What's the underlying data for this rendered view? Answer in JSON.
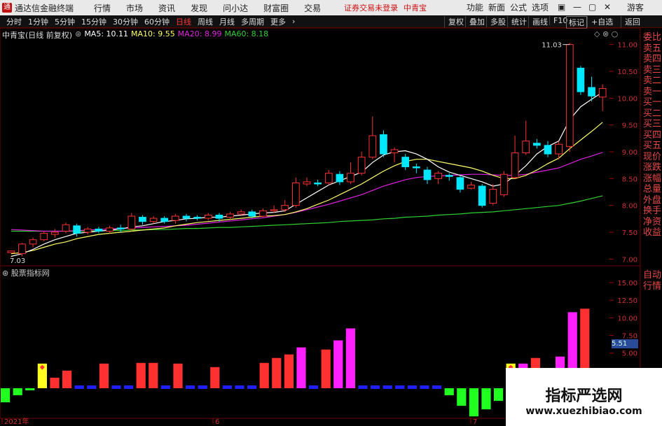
{
  "titlebar": {
    "app_title": "通达信金融终端",
    "menus": [
      "行情",
      "市场",
      "资讯",
      "发现",
      "问小达",
      "财富圈",
      "交易"
    ],
    "notice": "证券交易未登录",
    "stock_name": "中青宝",
    "right_menus": [
      "功能",
      "新面",
      "公式",
      "选项"
    ],
    "guest": "游客"
  },
  "toolbar": {
    "periods": [
      "分时",
      "1分钟",
      "5分钟",
      "15分钟",
      "30分钟",
      "60分钟",
      "日线",
      "周线",
      "月线",
      "多周期",
      "更多"
    ],
    "active_index": 6,
    "right_buttons": [
      "复权",
      "叠加",
      "多股",
      "统计",
      "画线",
      "F10",
      "标记",
      "+自选",
      "返回"
    ]
  },
  "info": {
    "title": "中青宝(日线 前复权)",
    "ma5": "MA5: 10.11",
    "ma10": "MA10: 9.55",
    "ma20": "MA20: 8.99",
    "ma60": "MA60: 8.18"
  },
  "colors": {
    "up": "#ff3030",
    "down": "#00e8ff",
    "ma5": "#ffffff",
    "ma10": "#ffff66",
    "ma20": "#e020e0",
    "ma60": "#30d030",
    "magenta_bar": "#ff20ff",
    "blue_bar": "#2020ff",
    "green_bar": "#20ff20",
    "yellow_bar": "#ffff20"
  },
  "sidebar": [
    "委比",
    "卖五",
    "卖四",
    "卖三",
    "卖二",
    "卖一",
    "买一",
    "买二",
    "买三",
    "买四",
    "买五",
    "现价",
    "涨跌",
    "涨幅",
    "总量",
    "外盘",
    "换手",
    "净资",
    "收益"
  ],
  "sidebar2": [
    "自动",
    "行情"
  ],
  "indicator_panel": {
    "name": "股票指标网",
    "current_value": "5.51"
  },
  "watermark": {
    "line1": "指标严选网",
    "line2": "www.xuezhibiao.com"
  },
  "chart_data": {
    "type": "candlestick",
    "price_axis": {
      "ticks": [
        7.0,
        7.5,
        8.0,
        8.5,
        9.0,
        9.5,
        10.0,
        10.5,
        11.0
      ],
      "labels": [
        "7.00",
        "7.50",
        "8.00",
        "8.50",
        "9.00",
        "9.50",
        "10.00",
        "10.50",
        "11.00"
      ],
      "range": [
        6.9,
        11.1
      ]
    },
    "annotations": {
      "high": "11.03",
      "low": "7.03"
    },
    "x_labels": [
      "2021年",
      "6",
      "7"
    ],
    "candles": [
      [
        7.12,
        7.15,
        7.04,
        7.03
      ],
      [
        7.1,
        7.28,
        7.3,
        7.05
      ],
      [
        7.28,
        7.36,
        7.4,
        7.22
      ],
      [
        7.36,
        7.48,
        7.52,
        7.33
      ],
      [
        7.46,
        7.5,
        7.56,
        7.4
      ],
      [
        7.52,
        7.64,
        7.68,
        7.48
      ],
      [
        7.62,
        7.48,
        7.66,
        7.42
      ],
      [
        7.5,
        7.56,
        7.6,
        7.46
      ],
      [
        7.56,
        7.52,
        7.6,
        7.48
      ],
      [
        7.52,
        7.58,
        7.62,
        7.48
      ],
      [
        7.58,
        7.56,
        7.64,
        7.5
      ],
      [
        7.56,
        7.8,
        7.86,
        7.52
      ],
      [
        7.78,
        7.7,
        7.82,
        7.64
      ],
      [
        7.7,
        7.76,
        7.8,
        7.66
      ],
      [
        7.76,
        7.7,
        7.8,
        7.66
      ],
      [
        7.72,
        7.8,
        7.84,
        7.66
      ],
      [
        7.8,
        7.76,
        7.84,
        7.7
      ],
      [
        7.78,
        7.76,
        7.82,
        7.72
      ],
      [
        7.76,
        7.82,
        7.86,
        7.72
      ],
      [
        7.82,
        7.76,
        7.86,
        7.7
      ],
      [
        7.78,
        7.84,
        7.88,
        7.74
      ],
      [
        7.84,
        7.88,
        7.92,
        7.8
      ],
      [
        7.88,
        7.8,
        7.92,
        7.76
      ],
      [
        7.8,
        7.9,
        7.94,
        7.78
      ],
      [
        7.9,
        7.92,
        8.0,
        7.86
      ],
      [
        7.92,
        8.0,
        8.1,
        7.88
      ],
      [
        8.0,
        8.42,
        8.52,
        7.96
      ],
      [
        8.4,
        8.44,
        8.52,
        8.36
      ],
      [
        8.42,
        8.4,
        8.48,
        8.36
      ],
      [
        8.42,
        8.6,
        8.66,
        8.38
      ],
      [
        8.58,
        8.44,
        8.64,
        8.38
      ],
      [
        8.44,
        8.6,
        8.8,
        8.4
      ],
      [
        8.6,
        8.9,
        9.0,
        8.56
      ],
      [
        8.9,
        9.3,
        9.66,
        8.86
      ],
      [
        9.32,
        8.96,
        9.4,
        8.9
      ],
      [
        8.98,
        9.04,
        9.08,
        8.8
      ],
      [
        8.9,
        8.72,
        8.96,
        8.66
      ],
      [
        8.72,
        8.7,
        8.78,
        8.6
      ],
      [
        8.66,
        8.48,
        8.72,
        8.4
      ],
      [
        8.5,
        8.6,
        8.64,
        8.4
      ],
      [
        8.56,
        8.54,
        8.6,
        8.46
      ],
      [
        8.52,
        8.3,
        8.56,
        8.24
      ],
      [
        8.32,
        8.38,
        8.44,
        8.3
      ],
      [
        8.36,
        8.0,
        8.4,
        7.96
      ],
      [
        8.04,
        8.3,
        8.4,
        8.0
      ],
      [
        8.2,
        8.58,
        8.64,
        8.16
      ],
      [
        8.52,
        8.98,
        9.3,
        8.5
      ],
      [
        8.98,
        9.2,
        9.58,
        8.94
      ],
      [
        9.16,
        9.12,
        9.24,
        9.06
      ],
      [
        9.12,
        8.96,
        9.2,
        8.9
      ],
      [
        8.96,
        9.14,
        9.2,
        8.86
      ],
      [
        9.1,
        11.0,
        11.03,
        9.0
      ],
      [
        10.56,
        10.12,
        10.6,
        10.06
      ],
      [
        10.2,
        10.04,
        10.4,
        9.94
      ],
      [
        10.02,
        10.18,
        10.26,
        9.76
      ]
    ],
    "ma5": [
      7.05,
      7.1,
      7.18,
      7.28,
      7.36,
      7.42,
      7.48,
      7.5,
      7.52,
      7.54,
      7.56,
      7.6,
      7.62,
      7.66,
      7.7,
      7.72,
      7.75,
      7.76,
      7.78,
      7.78,
      7.8,
      7.82,
      7.84,
      7.86,
      7.87,
      7.9,
      8.02,
      8.14,
      8.26,
      8.38,
      8.46,
      8.54,
      8.62,
      8.8,
      8.94,
      9.0,
      9.02,
      8.96,
      8.86,
      8.72,
      8.62,
      8.56,
      8.5,
      8.44,
      8.36,
      8.4,
      8.56,
      8.74,
      8.96,
      9.1,
      9.2,
      9.6,
      9.84,
      9.98,
      10.11
    ],
    "ma10": [
      7.1,
      7.12,
      7.16,
      7.22,
      7.28,
      7.32,
      7.38,
      7.42,
      7.46,
      7.48,
      7.5,
      7.52,
      7.54,
      7.56,
      7.58,
      7.62,
      7.65,
      7.68,
      7.7,
      7.72,
      7.74,
      7.76,
      7.78,
      7.8,
      7.81,
      7.83,
      7.88,
      7.94,
      8.02,
      8.1,
      8.2,
      8.3,
      8.4,
      8.52,
      8.64,
      8.74,
      8.82,
      8.86,
      8.86,
      8.82,
      8.78,
      8.74,
      8.7,
      8.64,
      8.56,
      8.5,
      8.5,
      8.56,
      8.66,
      8.78,
      8.88,
      9.06,
      9.22,
      9.38,
      9.55
    ],
    "ma20": [
      7.55,
      7.54,
      7.53,
      7.52,
      7.52,
      7.52,
      7.53,
      7.54,
      7.55,
      7.56,
      7.57,
      7.58,
      7.59,
      7.6,
      7.61,
      7.62,
      7.63,
      7.65,
      7.67,
      7.69,
      7.71,
      7.73,
      7.75,
      7.77,
      7.8,
      7.83,
      7.87,
      7.92,
      7.97,
      8.02,
      8.08,
      8.14,
      8.2,
      8.28,
      8.36,
      8.42,
      8.48,
      8.52,
      8.54,
      8.55,
      8.56,
      8.57,
      8.58,
      8.58,
      8.57,
      8.56,
      8.56,
      8.58,
      8.62,
      8.66,
      8.7,
      8.78,
      8.86,
      8.92,
      8.99
    ],
    "ma60": [
      7.52,
      7.52,
      7.52,
      7.52,
      7.52,
      7.52,
      7.52,
      7.52,
      7.53,
      7.53,
      7.53,
      7.54,
      7.54,
      7.55,
      7.55,
      7.56,
      7.57,
      7.57,
      7.58,
      7.59,
      7.59,
      7.6,
      7.61,
      7.62,
      7.63,
      7.64,
      7.65,
      7.66,
      7.67,
      7.68,
      7.7,
      7.71,
      7.72,
      7.73,
      7.75,
      7.76,
      7.78,
      7.79,
      7.8,
      7.82,
      7.83,
      7.84,
      7.86,
      7.87,
      7.88,
      7.9,
      7.92,
      7.94,
      7.96,
      7.98,
      8.0,
      8.04,
      8.08,
      8.13,
      8.18
    ],
    "indicator": {
      "axis_ticks": [
        5.0,
        7.5,
        10.0,
        12.5,
        15.0
      ],
      "axis_labels": [
        "5.00",
        "7.50",
        "10.00",
        "12.50",
        "15.00"
      ],
      "range": [
        0,
        16.2
      ],
      "values": [
        -2,
        -1,
        -0.3,
        3.5,
        1.5,
        2.5,
        0.4,
        0.4,
        3.5,
        0.4,
        0.4,
        3.6,
        3.6,
        0.4,
        3.5,
        0.4,
        0.4,
        3.0,
        0.4,
        0.4,
        0.4,
        3.6,
        4.3,
        4.8,
        5.8,
        0.4,
        5.5,
        6.8,
        8.5,
        0.4,
        0.4,
        0.4,
        0.4,
        0.4,
        0.4,
        0.4,
        -1,
        -2.5,
        -4,
        -3,
        -1.8,
        3.5,
        3.5,
        4.3,
        0.5,
        4.5,
        10.8,
        11.3
      ],
      "kinds": [
        "g",
        "g",
        "g",
        "y",
        "r",
        "r",
        "b",
        "b",
        "r",
        "b",
        "b",
        "r",
        "r",
        "b",
        "r",
        "b",
        "b",
        "r",
        "b",
        "b",
        "b",
        "r",
        "r",
        "r",
        "m",
        "b",
        "r",
        "m",
        "m",
        "b",
        "b",
        "b",
        "b",
        "b",
        "b",
        "b",
        "g",
        "g",
        "g",
        "g",
        "g",
        "y",
        "m",
        "r",
        "b",
        "m",
        "m",
        "r"
      ]
    }
  }
}
